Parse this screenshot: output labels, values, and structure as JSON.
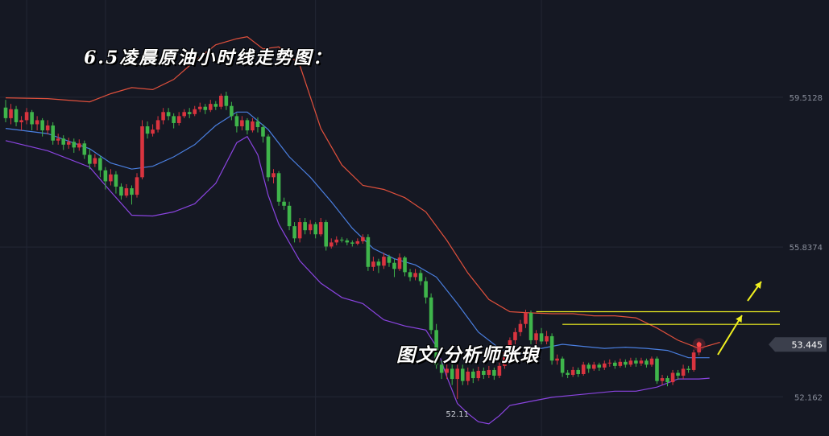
{
  "title": "6.5凌晨原油小时线走势图：",
  "watermark": "图文/分析师张琅",
  "current_price_label": "53.445",
  "low_marker_label": "52.11",
  "y_tick_labels": [
    "59.5128",
    "55.8374",
    "52.162"
  ],
  "colors": {
    "background": "#151823",
    "bull": "#d9343f",
    "bear": "#3fb54b",
    "upper_band": "#e0503c",
    "middle_band": "#4a7fe0",
    "lower_band": "#8a44e0",
    "resistance_lines": "#f0f020",
    "arrows": "#f0f020",
    "price_tag": "#3b3f4c",
    "grid": "#232735"
  },
  "chart_data": {
    "type": "candlestick",
    "title": "6.5凌晨原油小时线走势图：",
    "y_ticks": [
      59.5128,
      55.8374,
      52.162
    ],
    "ylim": [
      51.2,
      61.9
    ],
    "last_price": 53.445,
    "marked_low": 52.11,
    "bands": [
      "upper",
      "middle",
      "lower"
    ],
    "resistance_levels": [
      54.25,
      53.94
    ],
    "candles": [
      [
        59.26,
        59.0,
        59.45,
        58.9
      ],
      [
        59.0,
        59.22,
        59.35,
        58.85
      ],
      [
        59.22,
        58.9,
        59.3,
        58.8
      ],
      [
        58.9,
        58.95,
        59.05,
        58.7
      ],
      [
        58.95,
        59.15,
        59.25,
        58.85
      ],
      [
        59.15,
        58.85,
        59.2,
        58.7
      ],
      [
        58.85,
        58.95,
        59.05,
        58.7
      ],
      [
        58.95,
        58.7,
        59.0,
        58.55
      ],
      [
        58.7,
        58.82,
        58.95,
        58.6
      ],
      [
        58.82,
        58.45,
        58.9,
        58.35
      ],
      [
        58.45,
        58.5,
        58.62,
        58.35
      ],
      [
        58.5,
        58.35,
        58.58,
        58.22
      ],
      [
        58.35,
        58.42,
        58.52,
        58.25
      ],
      [
        58.42,
        58.28,
        58.5,
        58.15
      ],
      [
        58.28,
        58.38,
        58.48,
        58.2
      ],
      [
        58.38,
        58.1,
        58.45,
        58.0
      ],
      [
        58.1,
        57.88,
        58.25,
        57.75
      ],
      [
        57.88,
        58.02,
        58.12,
        57.8
      ],
      [
        58.02,
        57.72,
        58.08,
        57.55
      ],
      [
        57.72,
        57.45,
        57.8,
        57.25
      ],
      [
        57.45,
        57.62,
        57.75,
        57.35
      ],
      [
        57.62,
        57.32,
        57.7,
        57.15
      ],
      [
        57.32,
        57.1,
        57.4,
        57.0
      ],
      [
        57.1,
        57.28,
        57.38,
        57.05
      ],
      [
        57.28,
        57.12,
        57.35,
        56.88
      ],
      [
        57.12,
        57.55,
        57.65,
        57.05
      ],
      [
        57.55,
        58.8,
        58.95,
        57.5
      ],
      [
        58.8,
        58.62,
        58.92,
        58.5
      ],
      [
        58.62,
        58.72,
        58.85,
        58.55
      ],
      [
        58.72,
        58.95,
        59.05,
        58.65
      ],
      [
        58.95,
        59.15,
        59.25,
        58.85
      ],
      [
        59.15,
        59.05,
        59.25,
        58.95
      ],
      [
        59.05,
        58.88,
        59.12,
        58.75
      ],
      [
        58.88,
        59.05,
        59.15,
        58.82
      ],
      [
        59.05,
        59.15,
        59.22,
        59.0
      ],
      [
        59.15,
        59.1,
        59.25,
        59.0
      ],
      [
        59.1,
        59.22,
        59.3,
        59.05
      ],
      [
        59.22,
        59.28,
        59.38,
        59.15
      ],
      [
        59.28,
        59.2,
        59.35,
        59.1
      ],
      [
        59.2,
        59.35,
        59.45,
        59.15
      ],
      [
        59.35,
        59.28,
        59.42,
        59.2
      ],
      [
        59.28,
        59.55,
        59.6,
        59.22
      ],
      [
        59.55,
        59.3,
        59.65,
        59.2
      ],
      [
        59.3,
        59.05,
        59.4,
        58.95
      ],
      [
        59.05,
        58.8,
        59.12,
        58.65
      ],
      [
        58.8,
        58.95,
        59.05,
        58.7
      ],
      [
        58.95,
        58.7,
        59.0,
        58.6
      ],
      [
        58.7,
        58.92,
        59.0,
        58.65
      ],
      [
        58.92,
        58.78,
        59.02,
        58.65
      ],
      [
        58.78,
        58.55,
        58.85,
        58.4
      ],
      [
        58.55,
        57.55,
        58.6,
        57.45
      ],
      [
        57.55,
        57.65,
        57.75,
        57.4
      ],
      [
        57.65,
        56.95,
        57.7,
        56.85
      ],
      [
        56.95,
        56.85,
        57.05,
        56.75
      ],
      [
        56.85,
        56.35,
        56.95,
        56.25
      ],
      [
        56.35,
        56.05,
        56.45,
        55.95
      ],
      [
        56.05,
        56.45,
        56.55,
        55.95
      ],
      [
        56.45,
        56.25,
        56.55,
        56.15
      ],
      [
        56.25,
        56.4,
        56.5,
        56.15
      ],
      [
        56.4,
        56.15,
        56.45,
        56.05
      ],
      [
        56.15,
        56.45,
        56.55,
        56.1
      ],
      [
        56.45,
        55.85,
        56.5,
        55.75
      ],
      [
        55.85,
        55.95,
        56.05,
        55.8
      ],
      [
        55.95,
        56.02,
        56.1,
        55.88
      ],
      [
        56.02,
        56.0,
        56.08,
        55.95
      ],
      [
        56.0,
        55.95,
        56.05,
        55.88
      ],
      [
        55.95,
        55.92,
        56.0,
        55.85
      ],
      [
        55.92,
        55.98,
        56.05,
        55.88
      ],
      [
        55.98,
        56.08,
        56.15,
        55.92
      ],
      [
        56.08,
        55.35,
        56.15,
        55.25
      ],
      [
        55.35,
        55.48,
        55.6,
        55.25
      ],
      [
        55.48,
        55.38,
        55.55,
        55.2
      ],
      [
        55.38,
        55.6,
        55.7,
        55.3
      ],
      [
        55.6,
        55.45,
        55.65,
        55.35
      ],
      [
        55.45,
        55.3,
        55.55,
        55.1
      ],
      [
        55.3,
        55.58,
        55.68,
        55.25
      ],
      [
        55.58,
        55.22,
        55.62,
        55.12
      ],
      [
        55.22,
        55.1,
        55.3,
        55.0
      ],
      [
        55.1,
        55.2,
        55.3,
        55.02
      ],
      [
        55.2,
        55.0,
        55.28,
        54.9
      ],
      [
        55.0,
        54.6,
        55.1,
        54.45
      ],
      [
        54.6,
        53.8,
        54.7,
        53.7
      ],
      [
        53.8,
        52.95,
        53.95,
        52.85
      ],
      [
        52.95,
        52.75,
        53.05,
        52.6
      ],
      [
        52.75,
        52.85,
        53.0,
        52.6
      ],
      [
        52.85,
        52.6,
        52.95,
        52.45
      ],
      [
        52.6,
        52.85,
        52.95,
        52.11
      ],
      [
        52.85,
        52.55,
        52.95,
        52.45
      ],
      [
        52.55,
        52.78,
        52.88,
        52.45
      ],
      [
        52.78,
        52.62,
        52.85,
        52.5
      ],
      [
        52.62,
        52.8,
        52.9,
        52.55
      ],
      [
        52.8,
        52.7,
        52.88,
        52.6
      ],
      [
        52.7,
        52.82,
        52.92,
        52.62
      ],
      [
        52.82,
        52.68,
        52.88,
        52.58
      ],
      [
        52.68,
        52.92,
        53.0,
        52.62
      ],
      [
        52.92,
        53.25,
        53.32,
        52.85
      ],
      [
        53.25,
        53.55,
        53.62,
        53.18
      ],
      [
        53.55,
        53.75,
        53.85,
        53.45
      ],
      [
        53.75,
        53.95,
        54.05,
        53.65
      ],
      [
        53.95,
        54.22,
        54.3,
        53.85
      ],
      [
        54.22,
        53.55,
        54.28,
        53.45
      ],
      [
        53.55,
        53.72,
        53.8,
        53.45
      ],
      [
        53.72,
        53.52,
        53.85,
        53.45
      ],
      [
        53.52,
        53.65,
        53.78,
        53.45
      ],
      [
        53.65,
        53.05,
        53.72,
        52.95
      ],
      [
        53.05,
        53.1,
        53.2,
        52.95
      ],
      [
        53.1,
        52.75,
        53.15,
        52.65
      ],
      [
        52.75,
        52.7,
        52.82,
        52.62
      ],
      [
        52.7,
        52.82,
        52.9,
        52.65
      ],
      [
        52.82,
        52.72,
        52.88,
        52.65
      ],
      [
        52.72,
        52.95,
        53.02,
        52.68
      ],
      [
        52.95,
        52.85,
        53.0,
        52.75
      ],
      [
        52.85,
        52.95,
        53.02,
        52.8
      ],
      [
        52.95,
        52.88,
        53.0,
        52.8
      ],
      [
        52.88,
        52.98,
        53.05,
        52.82
      ],
      [
        52.98,
        53.0,
        53.08,
        52.9
      ],
      [
        53.0,
        52.92,
        53.05,
        52.85
      ],
      [
        52.92,
        53.02,
        53.1,
        52.88
      ],
      [
        53.02,
        52.95,
        53.08,
        52.88
      ],
      [
        52.95,
        53.05,
        53.12,
        52.9
      ],
      [
        53.05,
        52.98,
        53.12,
        52.9
      ],
      [
        52.98,
        53.05,
        53.12,
        52.92
      ],
      [
        53.05,
        52.95,
        53.1,
        52.88
      ],
      [
        52.95,
        53.1,
        53.15,
        52.9
      ],
      [
        53.1,
        52.55,
        53.15,
        52.48
      ],
      [
        52.55,
        52.62,
        52.7,
        52.45
      ],
      [
        52.62,
        52.52,
        52.68,
        52.42
      ],
      [
        52.52,
        52.75,
        52.82,
        52.45
      ],
      [
        52.75,
        52.68,
        52.82,
        52.58
      ],
      [
        52.68,
        52.85,
        52.95,
        52.6
      ],
      [
        52.85,
        52.82,
        52.92,
        52.75
      ],
      [
        52.82,
        53.25,
        53.32,
        52.78
      ],
      [
        53.25,
        53.45,
        53.52,
        53.18
      ]
    ],
    "upper_band": [
      [
        0,
        59.5
      ],
      [
        8,
        59.48
      ],
      [
        16,
        59.4
      ],
      [
        20,
        59.6
      ],
      [
        24,
        59.75
      ],
      [
        28,
        59.7
      ],
      [
        32,
        59.95
      ],
      [
        36,
        60.4
      ],
      [
        40,
        60.8
      ],
      [
        44,
        60.95
      ],
      [
        46,
        61.0
      ],
      [
        49,
        60.7
      ],
      [
        52,
        60.75
      ],
      [
        54,
        60.55
      ],
      [
        56,
        60.3
      ],
      [
        60,
        58.75
      ],
      [
        64,
        57.85
      ],
      [
        68,
        57.35
      ],
      [
        72,
        57.25
      ],
      [
        76,
        57.05
      ],
      [
        80,
        56.7
      ],
      [
        84,
        56.0
      ],
      [
        88,
        55.2
      ],
      [
        92,
        54.55
      ],
      [
        96,
        54.25
      ],
      [
        100,
        54.22
      ],
      [
        104,
        54.2
      ],
      [
        108,
        54.2
      ],
      [
        112,
        54.15
      ],
      [
        116,
        54.15
      ],
      [
        120,
        54.1
      ],
      [
        124,
        53.85
      ],
      [
        128,
        53.55
      ],
      [
        132,
        53.35
      ],
      [
        136,
        53.5
      ]
    ],
    "middle_band": [
      [
        0,
        58.75
      ],
      [
        8,
        58.62
      ],
      [
        16,
        58.25
      ],
      [
        20,
        57.9
      ],
      [
        24,
        57.75
      ],
      [
        28,
        57.82
      ],
      [
        32,
        58.05
      ],
      [
        36,
        58.35
      ],
      [
        40,
        58.82
      ],
      [
        44,
        59.15
      ],
      [
        46,
        59.15
      ],
      [
        50,
        58.72
      ],
      [
        54,
        58.05
      ],
      [
        58,
        57.55
      ],
      [
        62,
        56.95
      ],
      [
        66,
        56.3
      ],
      [
        70,
        55.8
      ],
      [
        74,
        55.55
      ],
      [
        78,
        55.4
      ],
      [
        82,
        55.1
      ],
      [
        86,
        54.45
      ],
      [
        90,
        53.75
      ],
      [
        94,
        53.35
      ],
      [
        98,
        53.2
      ],
      [
        102,
        53.35
      ],
      [
        106,
        53.45
      ],
      [
        110,
        53.4
      ],
      [
        114,
        53.35
      ],
      [
        118,
        53.38
      ],
      [
        122,
        53.35
      ],
      [
        126,
        53.3
      ],
      [
        130,
        53.12
      ],
      [
        134,
        53.12
      ]
    ],
    "lower_band": [
      [
        0,
        58.45
      ],
      [
        8,
        58.2
      ],
      [
        16,
        57.8
      ],
      [
        20,
        57.2
      ],
      [
        24,
        56.62
      ],
      [
        28,
        56.6
      ],
      [
        32,
        56.7
      ],
      [
        36,
        56.9
      ],
      [
        40,
        57.4
      ],
      [
        44,
        58.4
      ],
      [
        46,
        58.55
      ],
      [
        48,
        58.1
      ],
      [
        50,
        57.1
      ],
      [
        52,
        56.4
      ],
      [
        56,
        55.5
      ],
      [
        60,
        54.95
      ],
      [
        64,
        54.6
      ],
      [
        68,
        54.45
      ],
      [
        72,
        54.05
      ],
      [
        76,
        53.9
      ],
      [
        80,
        53.8
      ],
      [
        82,
        53.4
      ],
      [
        84,
        52.65
      ],
      [
        86,
        52.0
      ],
      [
        88,
        51.75
      ],
      [
        90,
        51.55
      ],
      [
        92,
        51.5
      ],
      [
        94,
        51.7
      ],
      [
        96,
        51.95
      ],
      [
        100,
        52.05
      ],
      [
        104,
        52.15
      ],
      [
        108,
        52.2
      ],
      [
        112,
        52.25
      ],
      [
        116,
        52.3
      ],
      [
        120,
        52.3
      ],
      [
        124,
        52.4
      ],
      [
        128,
        52.6
      ],
      [
        132,
        52.6
      ],
      [
        134,
        52.62
      ]
    ]
  }
}
